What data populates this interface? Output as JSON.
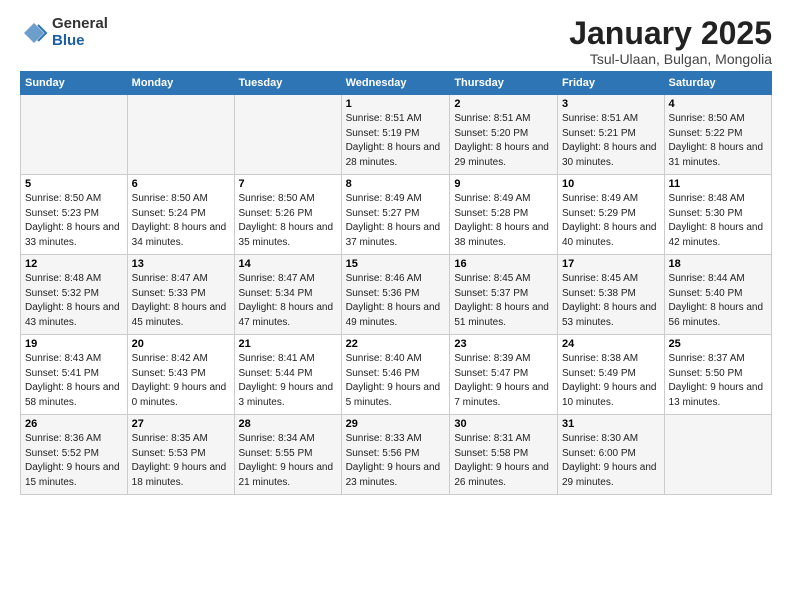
{
  "logo": {
    "general": "General",
    "blue": "Blue"
  },
  "title": "January 2025",
  "location": "Tsul-Ulaan, Bulgan, Mongolia",
  "headers": [
    "Sunday",
    "Monday",
    "Tuesday",
    "Wednesday",
    "Thursday",
    "Friday",
    "Saturday"
  ],
  "weeks": [
    [
      {
        "num": "",
        "info": ""
      },
      {
        "num": "",
        "info": ""
      },
      {
        "num": "",
        "info": ""
      },
      {
        "num": "1",
        "info": "Sunrise: 8:51 AM\nSunset: 5:19 PM\nDaylight: 8 hours\nand 28 minutes."
      },
      {
        "num": "2",
        "info": "Sunrise: 8:51 AM\nSunset: 5:20 PM\nDaylight: 8 hours\nand 29 minutes."
      },
      {
        "num": "3",
        "info": "Sunrise: 8:51 AM\nSunset: 5:21 PM\nDaylight: 8 hours\nand 30 minutes."
      },
      {
        "num": "4",
        "info": "Sunrise: 8:50 AM\nSunset: 5:22 PM\nDaylight: 8 hours\nand 31 minutes."
      }
    ],
    [
      {
        "num": "5",
        "info": "Sunrise: 8:50 AM\nSunset: 5:23 PM\nDaylight: 8 hours\nand 33 minutes."
      },
      {
        "num": "6",
        "info": "Sunrise: 8:50 AM\nSunset: 5:24 PM\nDaylight: 8 hours\nand 34 minutes."
      },
      {
        "num": "7",
        "info": "Sunrise: 8:50 AM\nSunset: 5:26 PM\nDaylight: 8 hours\nand 35 minutes."
      },
      {
        "num": "8",
        "info": "Sunrise: 8:49 AM\nSunset: 5:27 PM\nDaylight: 8 hours\nand 37 minutes."
      },
      {
        "num": "9",
        "info": "Sunrise: 8:49 AM\nSunset: 5:28 PM\nDaylight: 8 hours\nand 38 minutes."
      },
      {
        "num": "10",
        "info": "Sunrise: 8:49 AM\nSunset: 5:29 PM\nDaylight: 8 hours\nand 40 minutes."
      },
      {
        "num": "11",
        "info": "Sunrise: 8:48 AM\nSunset: 5:30 PM\nDaylight: 8 hours\nand 42 minutes."
      }
    ],
    [
      {
        "num": "12",
        "info": "Sunrise: 8:48 AM\nSunset: 5:32 PM\nDaylight: 8 hours\nand 43 minutes."
      },
      {
        "num": "13",
        "info": "Sunrise: 8:47 AM\nSunset: 5:33 PM\nDaylight: 8 hours\nand 45 minutes."
      },
      {
        "num": "14",
        "info": "Sunrise: 8:47 AM\nSunset: 5:34 PM\nDaylight: 8 hours\nand 47 minutes."
      },
      {
        "num": "15",
        "info": "Sunrise: 8:46 AM\nSunset: 5:36 PM\nDaylight: 8 hours\nand 49 minutes."
      },
      {
        "num": "16",
        "info": "Sunrise: 8:45 AM\nSunset: 5:37 PM\nDaylight: 8 hours\nand 51 minutes."
      },
      {
        "num": "17",
        "info": "Sunrise: 8:45 AM\nSunset: 5:38 PM\nDaylight: 8 hours\nand 53 minutes."
      },
      {
        "num": "18",
        "info": "Sunrise: 8:44 AM\nSunset: 5:40 PM\nDaylight: 8 hours\nand 56 minutes."
      }
    ],
    [
      {
        "num": "19",
        "info": "Sunrise: 8:43 AM\nSunset: 5:41 PM\nDaylight: 8 hours\nand 58 minutes."
      },
      {
        "num": "20",
        "info": "Sunrise: 8:42 AM\nSunset: 5:43 PM\nDaylight: 9 hours\nand 0 minutes."
      },
      {
        "num": "21",
        "info": "Sunrise: 8:41 AM\nSunset: 5:44 PM\nDaylight: 9 hours\nand 3 minutes."
      },
      {
        "num": "22",
        "info": "Sunrise: 8:40 AM\nSunset: 5:46 PM\nDaylight: 9 hours\nand 5 minutes."
      },
      {
        "num": "23",
        "info": "Sunrise: 8:39 AM\nSunset: 5:47 PM\nDaylight: 9 hours\nand 7 minutes."
      },
      {
        "num": "24",
        "info": "Sunrise: 8:38 AM\nSunset: 5:49 PM\nDaylight: 9 hours\nand 10 minutes."
      },
      {
        "num": "25",
        "info": "Sunrise: 8:37 AM\nSunset: 5:50 PM\nDaylight: 9 hours\nand 13 minutes."
      }
    ],
    [
      {
        "num": "26",
        "info": "Sunrise: 8:36 AM\nSunset: 5:52 PM\nDaylight: 9 hours\nand 15 minutes."
      },
      {
        "num": "27",
        "info": "Sunrise: 8:35 AM\nSunset: 5:53 PM\nDaylight: 9 hours\nand 18 minutes."
      },
      {
        "num": "28",
        "info": "Sunrise: 8:34 AM\nSunset: 5:55 PM\nDaylight: 9 hours\nand 21 minutes."
      },
      {
        "num": "29",
        "info": "Sunrise: 8:33 AM\nSunset: 5:56 PM\nDaylight: 9 hours\nand 23 minutes."
      },
      {
        "num": "30",
        "info": "Sunrise: 8:31 AM\nSunset: 5:58 PM\nDaylight: 9 hours\nand 26 minutes."
      },
      {
        "num": "31",
        "info": "Sunrise: 8:30 AM\nSunset: 6:00 PM\nDaylight: 9 hours\nand 29 minutes."
      },
      {
        "num": "",
        "info": ""
      }
    ]
  ]
}
